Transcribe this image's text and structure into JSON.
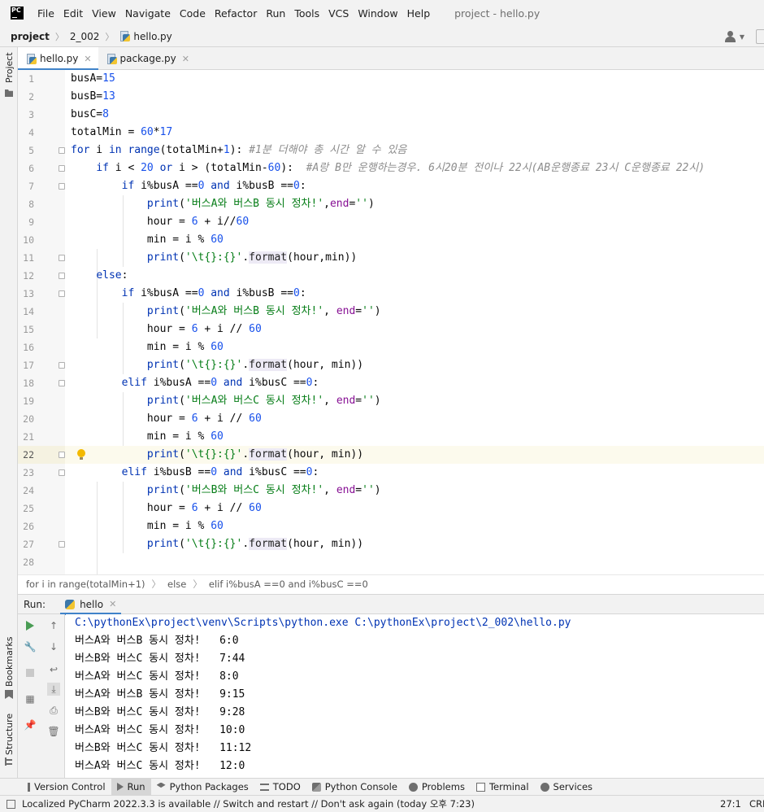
{
  "menubar": {
    "logo": "PC",
    "items": [
      "File",
      "Edit",
      "View",
      "Navigate",
      "Code",
      "Refactor",
      "Run",
      "Tools",
      "VCS",
      "Window",
      "Help"
    ],
    "window_title": "project - hello.py"
  },
  "navbar": {
    "project": "project",
    "folder": "2_002",
    "file": "hello.py"
  },
  "left_strip": {
    "project": "Project",
    "bookmarks": "Bookmarks",
    "structure": "Structure"
  },
  "tabs": [
    {
      "label": "hello.py",
      "active": true
    },
    {
      "label": "package.py",
      "active": false
    }
  ],
  "editor": {
    "current_line": 22,
    "line_count": 28
  },
  "breadcrumbs": [
    "for i in range(totalMin+1)",
    "else",
    "elif i%busA ==0 and i%busC ==0"
  ],
  "run": {
    "label": "Run:",
    "tab": "hello",
    "command": "C:\\pythonEx\\project\\venv\\Scripts\\python.exe C:\\pythonEx\\project\\2_002\\hello.py",
    "output": [
      "버스A와 버스B 동시 정차!   6:0",
      "버스B와 버스C 동시 정차!   7:44",
      "버스A와 버스C 동시 정차!   8:0",
      "버스A와 버스B 동시 정차!   9:15",
      "버스B와 버스C 동시 정차!   9:28",
      "버스A와 버스C 동시 정차!   10:0",
      "버스B와 버스C 동시 정차!   11:12",
      "버스A와 버스C 동시 정차!   12:0"
    ]
  },
  "tool_windows": [
    "Version Control",
    "Run",
    "Python Packages",
    "TODO",
    "Python Console",
    "Problems",
    "Terminal",
    "Services"
  ],
  "status": {
    "message": "Localized PyCharm 2022.3.3 is available // Switch and restart // Don't ask again (today 오후 7:23)",
    "position": "27:1",
    "encoding": "CRLF"
  },
  "colors": {
    "accent": "#4083c9",
    "keyword": "#0033b3",
    "number": "#1750eb",
    "string": "#067d17",
    "comment": "#8c8c8c"
  }
}
